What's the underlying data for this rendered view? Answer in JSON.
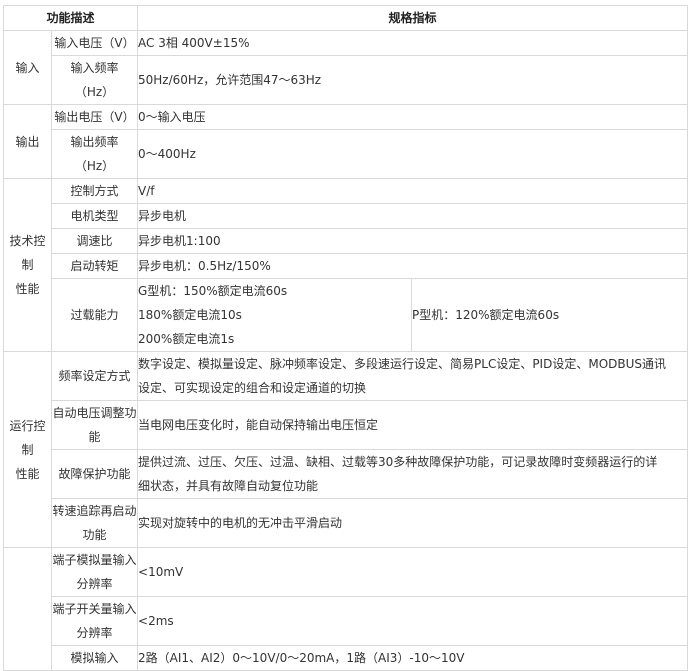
{
  "header": {
    "feature": "功能描述",
    "spec": "规格指标"
  },
  "input": {
    "category": "输入",
    "voltage_label": "输入电压（V）",
    "voltage_value": "AC 3相 400V±15%",
    "freq_label_1": "输入频率",
    "freq_label_2": "（Hz）",
    "freq_value": "50Hz/60Hz，允许范围47～63Hz"
  },
  "output": {
    "category": "输出",
    "voltage_label": "输出电压（V）",
    "voltage_value": "0～输入电压",
    "freq_label_1": "输出频率",
    "freq_label_2": "（Hz）",
    "freq_value": "0～400Hz"
  },
  "tech": {
    "category_1": "技术控制",
    "category_2": "性能",
    "control_label": "控制方式",
    "control_value": "V/f",
    "motor_label": "电机类型",
    "motor_value": "异步电机",
    "speed_label": "调速比",
    "speed_value": "异步电机1:100",
    "torque_label": "启动转矩",
    "torque_value": "异步电机：0.5Hz/150%",
    "overload_label": "过载能力",
    "overload_g_1": "G型机：150%额定电流60s",
    "overload_g_2": "180%额定电流10s",
    "overload_g_3": "200%额定电流1s",
    "overload_p": "P型机：120%额定电流60s"
  },
  "run": {
    "category_1": "运行控制",
    "category_2": "性能",
    "freq_setting_label": "频率设定方式",
    "freq_setting_value_1": "数字设定、模拟量设定、脉冲频率设定、多段速运行设定、简易PLC设定、PID设定、MODBUS通讯",
    "freq_setting_value_2": "设定、可实现设定的组合和设定通道的切换",
    "avr_label_1": "自动电压调整功",
    "avr_label_2": "能",
    "avr_value": "当电网电压变化时，能自动保持输出电压恒定",
    "fault_label": "故障保护功能",
    "fault_value_1": "提供过流、过压、欠压、过温、缺相、过载等30多种故障保护功能，可记录故障时变频器运行的详",
    "fault_value_2": "细状态，并具有故障自动复位功能",
    "tracking_label_1": "转速追踪再启动",
    "tracking_label_2": "功能",
    "tracking_value": "实现对旋转中的电机的无冲击平滑启动"
  },
  "io": {
    "analog_res_label_1": "端子模拟量输入",
    "analog_res_label_2": "分辨率",
    "analog_res_value": "<10mV",
    "switch_res_label_1": "端子开关量输入",
    "switch_res_label_2": "分辨率",
    "switch_res_value": "<2ms",
    "analog_in_label": "模拟输入",
    "analog_in_value": "2路（AI1、AI2）0～10V/0～20mA，1路（AI3）-10～10V"
  }
}
